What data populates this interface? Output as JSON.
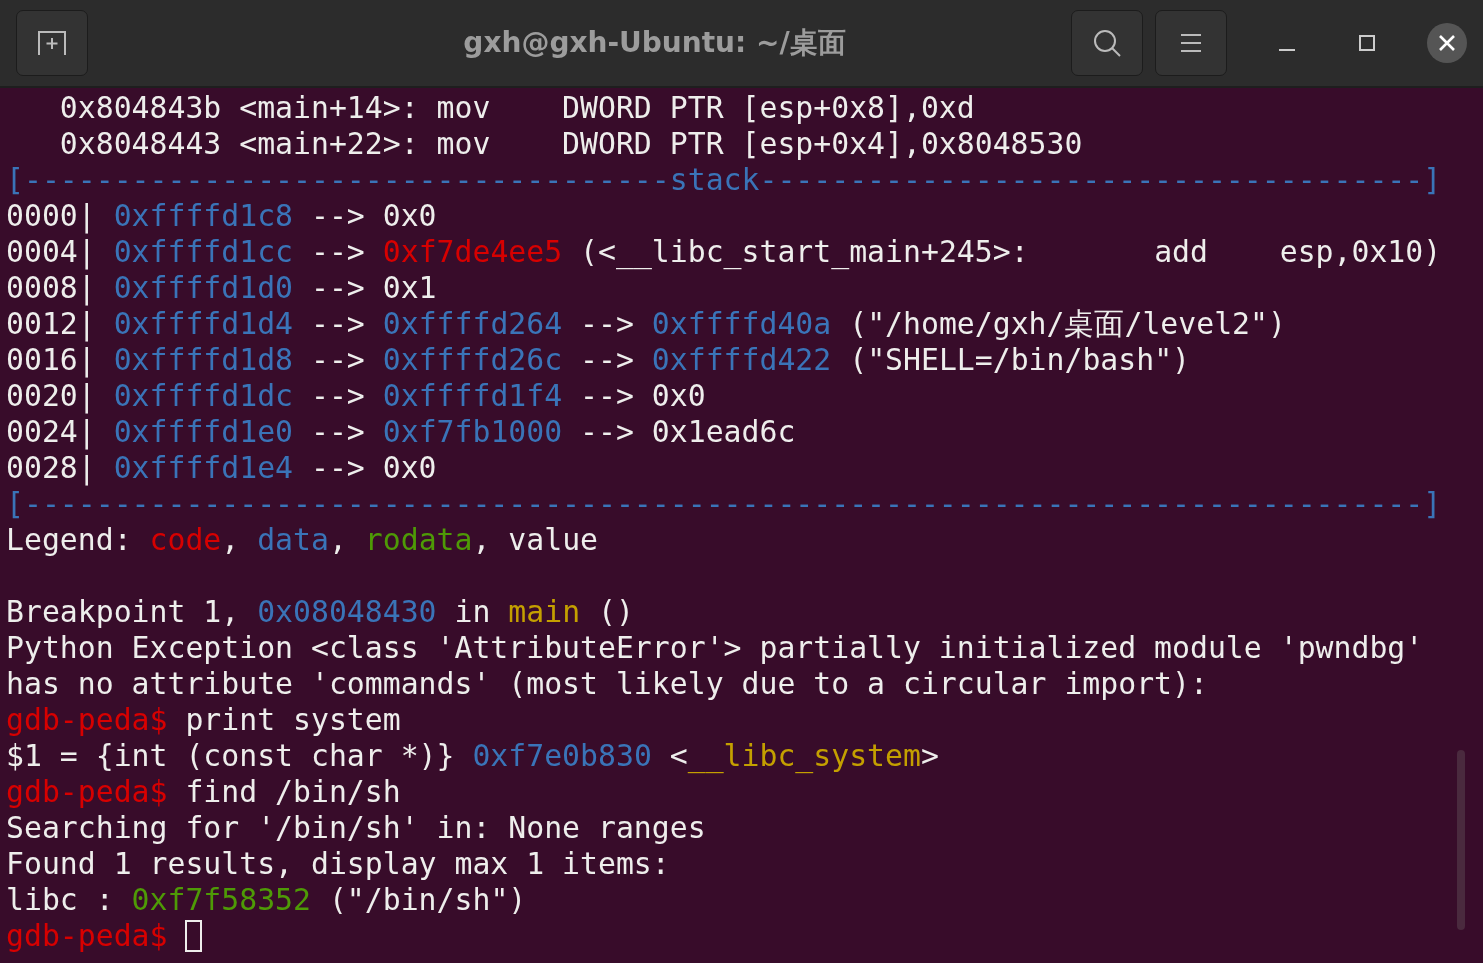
{
  "window": {
    "title": "gxh@gxh-Ubuntu: ~/桌面"
  },
  "terminal": {
    "lines": [
      {
        "kind": "text",
        "segments": [
          {
            "text": "   0x804843b <main+14>: mov    DWORD PTR [esp+0x8],0xd",
            "color": "#eeeeec"
          }
        ]
      },
      {
        "kind": "text",
        "segments": [
          {
            "text": "   0x8048443 <main+22>: mov    DWORD PTR [esp+0x4],0x8048530",
            "color": "#eeeeec"
          }
        ]
      },
      {
        "kind": "text",
        "segments": [
          {
            "text": "[------------------------------------stack-------------------------------------]",
            "color": "#3a74b8"
          }
        ]
      },
      {
        "kind": "text",
        "segments": [
          {
            "text": "0000| ",
            "color": "#eeeeec"
          },
          {
            "text": "0xffffd1c8",
            "color": "#3a74b8"
          },
          {
            "text": " --> 0x0",
            "color": "#eeeeec"
          }
        ]
      },
      {
        "kind": "text",
        "segments": [
          {
            "text": "0004| ",
            "color": "#eeeeec"
          },
          {
            "text": "0xffffd1cc",
            "color": "#3a74b8"
          },
          {
            "text": " --> ",
            "color": "#eeeeec"
          },
          {
            "text": "0xf7de4ee5",
            "color": "#d70000"
          },
          {
            "text": " (<__libc_start_main+245>:       add    esp,0x10)",
            "color": "#eeeeec"
          }
        ]
      },
      {
        "kind": "text",
        "segments": [
          {
            "text": "0008| ",
            "color": "#eeeeec"
          },
          {
            "text": "0xffffd1d0",
            "color": "#3a74b8"
          },
          {
            "text": " --> 0x1",
            "color": "#eeeeec"
          }
        ]
      },
      {
        "kind": "text",
        "segments": [
          {
            "text": "0012| ",
            "color": "#eeeeec"
          },
          {
            "text": "0xffffd1d4",
            "color": "#3a74b8"
          },
          {
            "text": " --> ",
            "color": "#eeeeec"
          },
          {
            "text": "0xffffd264",
            "color": "#3a74b8"
          },
          {
            "text": " --> ",
            "color": "#eeeeec"
          },
          {
            "text": "0xffffd40a",
            "color": "#3a74b8"
          },
          {
            "text": " (\"/home/gxh/桌面/level2\")",
            "color": "#eeeeec"
          }
        ]
      },
      {
        "kind": "text",
        "segments": [
          {
            "text": "0016| ",
            "color": "#eeeeec"
          },
          {
            "text": "0xffffd1d8",
            "color": "#3a74b8"
          },
          {
            "text": " --> ",
            "color": "#eeeeec"
          },
          {
            "text": "0xffffd26c",
            "color": "#3a74b8"
          },
          {
            "text": " --> ",
            "color": "#eeeeec"
          },
          {
            "text": "0xffffd422",
            "color": "#3a74b8"
          },
          {
            "text": " (\"SHELL=/bin/bash\")",
            "color": "#eeeeec"
          }
        ]
      },
      {
        "kind": "text",
        "segments": [
          {
            "text": "0020| ",
            "color": "#eeeeec"
          },
          {
            "text": "0xffffd1dc",
            "color": "#3a74b8"
          },
          {
            "text": " --> ",
            "color": "#eeeeec"
          },
          {
            "text": "0xffffd1f4",
            "color": "#3a74b8"
          },
          {
            "text": " --> 0x0",
            "color": "#eeeeec"
          }
        ]
      },
      {
        "kind": "text",
        "segments": [
          {
            "text": "0024| ",
            "color": "#eeeeec"
          },
          {
            "text": "0xffffd1e0",
            "color": "#3a74b8"
          },
          {
            "text": " --> ",
            "color": "#eeeeec"
          },
          {
            "text": "0xf7fb1000",
            "color": "#3a74b8"
          },
          {
            "text": " --> 0x1ead6c",
            "color": "#eeeeec"
          }
        ]
      },
      {
        "kind": "text",
        "segments": [
          {
            "text": "0028| ",
            "color": "#eeeeec"
          },
          {
            "text": "0xffffd1e4",
            "color": "#3a74b8"
          },
          {
            "text": " --> 0x0",
            "color": "#eeeeec"
          }
        ]
      },
      {
        "kind": "text",
        "segments": [
          {
            "text": "[------------------------------------------------------------------------------]",
            "color": "#3a74b8"
          }
        ]
      },
      {
        "kind": "text",
        "segments": [
          {
            "text": "Legend: ",
            "color": "#eeeeec"
          },
          {
            "text": "code",
            "color": "#d70000"
          },
          {
            "text": ", ",
            "color": "#eeeeec"
          },
          {
            "text": "data",
            "color": "#3a74b8"
          },
          {
            "text": ", ",
            "color": "#eeeeec"
          },
          {
            "text": "rodata",
            "color": "#4e9a06"
          },
          {
            "text": ", value",
            "color": "#eeeeec"
          }
        ]
      },
      {
        "kind": "blank"
      },
      {
        "kind": "text",
        "segments": [
          {
            "text": "Breakpoint 1, ",
            "color": "#eeeeec"
          },
          {
            "text": "0x08048430",
            "color": "#3a74b8"
          },
          {
            "text": " in ",
            "color": "#eeeeec"
          },
          {
            "text": "main",
            "color": "#c4a000"
          },
          {
            "text": " ()",
            "color": "#eeeeec"
          }
        ]
      },
      {
        "kind": "text",
        "segments": [
          {
            "text": "Python Exception <class 'AttributeError'> partially initialized module 'pwndbg'",
            "color": "#eeeeec"
          }
        ]
      },
      {
        "kind": "text",
        "segments": [
          {
            "text": "has no attribute 'commands' (most likely due to a circular import):",
            "color": "#eeeeec"
          }
        ]
      },
      {
        "kind": "text",
        "segments": [
          {
            "text": "gdb-peda$",
            "color": "#d70000"
          },
          {
            "text": " print system",
            "color": "#eeeeec"
          }
        ]
      },
      {
        "kind": "text",
        "segments": [
          {
            "text": "$1 = {int (const char *)} ",
            "color": "#eeeeec"
          },
          {
            "text": "0xf7e0b830",
            "color": "#3a74b8"
          },
          {
            "text": " <",
            "color": "#eeeeec"
          },
          {
            "text": "__libc_system",
            "color": "#c4a000"
          },
          {
            "text": ">",
            "color": "#eeeeec"
          }
        ]
      },
      {
        "kind": "text",
        "segments": [
          {
            "text": "gdb-peda$",
            "color": "#d70000"
          },
          {
            "text": " find /bin/sh",
            "color": "#eeeeec"
          }
        ]
      },
      {
        "kind": "text",
        "segments": [
          {
            "text": "Searching for '/bin/sh' in: None ranges",
            "color": "#eeeeec"
          }
        ]
      },
      {
        "kind": "text",
        "segments": [
          {
            "text": "Found 1 results, display max 1 items:",
            "color": "#eeeeec"
          }
        ]
      },
      {
        "kind": "text",
        "segments": [
          {
            "text": "libc : ",
            "color": "#eeeeec"
          },
          {
            "text": "0xf7f58352",
            "color": "#4e9a06"
          },
          {
            "text": " (\"/bin/sh\")",
            "color": "#eeeeec"
          }
        ]
      },
      {
        "kind": "text",
        "cursor": true,
        "segments": [
          {
            "text": "gdb-peda$",
            "color": "#d70000"
          }
        ]
      }
    ]
  }
}
